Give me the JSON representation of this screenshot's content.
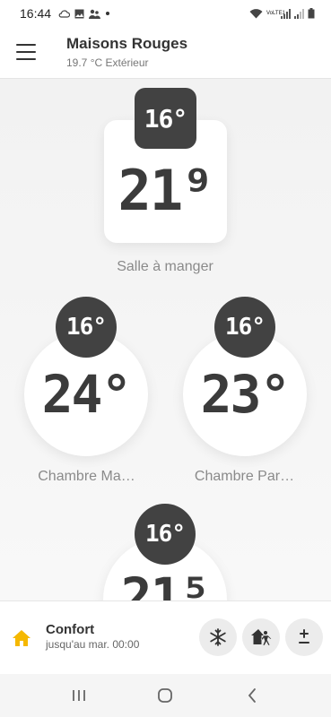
{
  "status_bar": {
    "time": "16:44",
    "network_label": "VoLTE1"
  },
  "header": {
    "home_name": "Maisons Rouges",
    "outdoor_temp": "19.7 °C Extérieur"
  },
  "rooms": [
    {
      "name": "Salle à manger",
      "current_temp": "21.9",
      "current_display": "21⁹",
      "setpoint": "16°"
    },
    {
      "name": "Chambre Ma…",
      "current_temp": "24",
      "current_display": "24°",
      "setpoint": "16°"
    },
    {
      "name": "Chambre Par…",
      "current_temp": "23",
      "current_display": "23°",
      "setpoint": "16°"
    },
    {
      "name": "",
      "current_temp": "21.5",
      "current_display": "21⁵",
      "setpoint": "16°"
    }
  ],
  "mode_bar": {
    "mode_name": "Confort",
    "mode_until": "jusqu'au mar. 00:00",
    "icons": [
      "home-icon",
      "snowflake-icon",
      "away-icon",
      "plus-minus-icon"
    ],
    "accent_color": "#f5b800"
  },
  "colors": {
    "setpoint_bg": "#424242",
    "valve_bg": "#ffffff",
    "temp_text": "#3b3b3b",
    "label_text": "#8a8a8a"
  }
}
